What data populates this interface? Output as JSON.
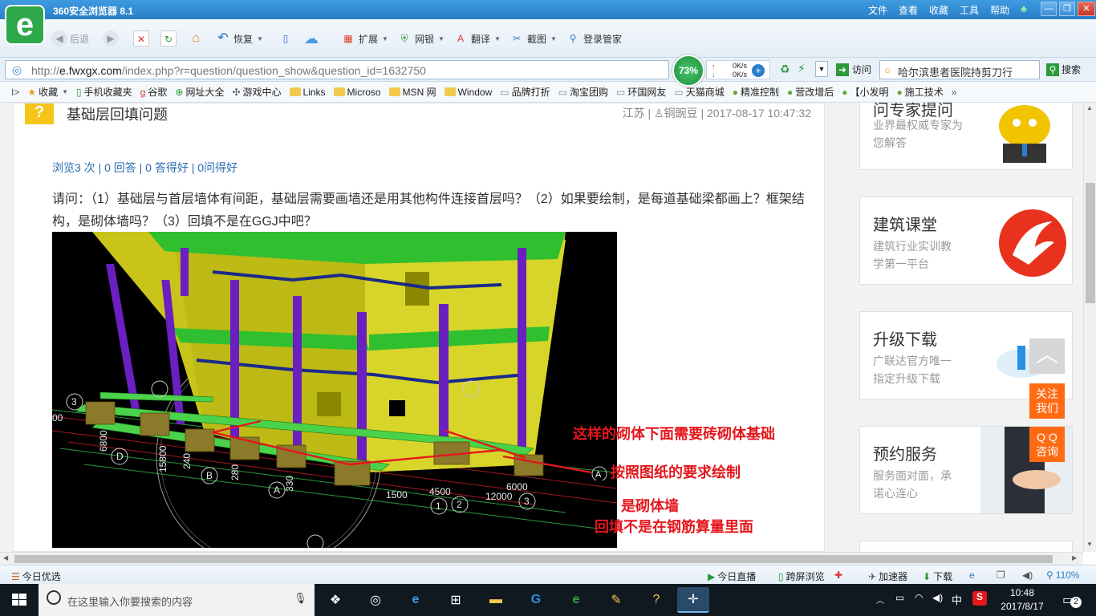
{
  "window": {
    "title": "360安全浏览器 8.1",
    "menus": [
      "文件",
      "查看",
      "收藏",
      "工具",
      "帮助"
    ]
  },
  "toolbar": {
    "back": "后退",
    "restore": "恢复",
    "extend": "扩展",
    "netbank": "网银",
    "translate": "翻译",
    "screenshot": "截图",
    "login": "登录管家"
  },
  "address": {
    "scheme": "http://",
    "domain": "e.fwxgx.com",
    "path": "/index.php?r=question/question_show&question_id=1632750",
    "speed": "73%",
    "up": "0K/s",
    "down": "0K/s",
    "visit": "访问",
    "search_value": "哈尔滨患者医院持剪刀行",
    "search_label": "搜索"
  },
  "bookmarks": [
    "收藏",
    "手机收藏夹",
    "谷歌",
    "网址大全",
    "游戏中心",
    "Links",
    "Microso",
    "MSN 网",
    "Window",
    "品牌打折",
    "淘宝团购",
    "环国网友",
    "天猫商城",
    "精准控制",
    "营改增后",
    "【小发明",
    "施工技术"
  ],
  "question": {
    "title": "基础层回填问题",
    "location": "江苏",
    "user": "铜豌豆",
    "date": "2017-08-17 10:47:32",
    "stats": "浏览3 次 | 0 回答 | 0 答得好 | 0问得好",
    "body": "请问：（1）基础层与首层墙体有间距，基础层需要画墙还是用其他构件连接首层吗？（2）如果要绘制，是每道基础梁都画上？框架结构，是砌体墙吗？（3）回填不是在GGJ中吧？"
  },
  "annotations": [
    "这样的砌体下面需要砖砌体基础",
    "按照图纸的要求绘制",
    "是砌体墙",
    "回填不是在钢筋算量里面"
  ],
  "cad_labels": {
    "axis_numbers": [
      "3",
      "D",
      "B",
      "A",
      "1",
      "2",
      "3",
      "A"
    ],
    "dims": [
      "00",
      "6800",
      "15800",
      "240",
      "280",
      "330",
      "1500",
      "4500",
      "6000",
      "12000"
    ]
  },
  "sidebar": {
    "expert_title": "问专家提问",
    "expert_sub": "业界最权威专家为您解答",
    "course_title": "建筑课堂",
    "course_sub1": "建筑行业实训教",
    "course_sub2": "学第一平台",
    "upgrade_title": "升级下载",
    "upgrade_sub1": "广联达官方唯一",
    "upgrade_sub2": "指定升级下载",
    "service_title": "预约服务",
    "service_sub1": "服务面对面，承",
    "service_sub2": "诺心连心",
    "follow1": "关注",
    "follow2": "我们",
    "qq1": "Q Q",
    "qq2": "咨询"
  },
  "status": {
    "today": "今日优选",
    "live": "今日直播",
    "cross": "跨屏浏览",
    "accel": "加速器",
    "download": "下载",
    "zoom": "110%"
  },
  "taskbar": {
    "search_placeholder": "在这里输入你要搜索的内容",
    "time": "10:48",
    "date": "2017/8/17",
    "ime": "中",
    "notifications": "2"
  },
  "colors": {
    "accent": "#2b7fc8",
    "annotation_red": "#e4171d",
    "wall_yellow": "#c8c41a",
    "column_purple": "#6a1fc0",
    "beam_green": "#3cc63c",
    "orange_button": "#ff6a13"
  }
}
